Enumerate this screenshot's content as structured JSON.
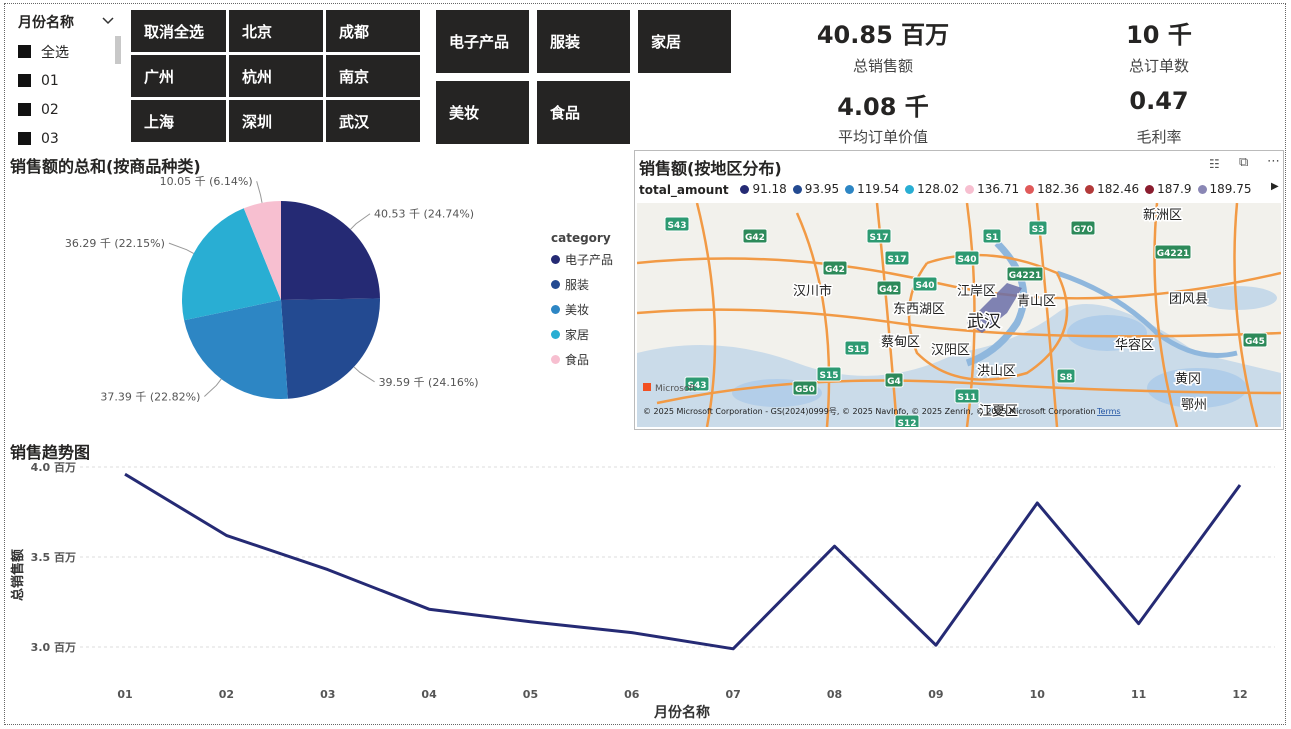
{
  "month_slicer": {
    "title": "月份名称",
    "items": [
      "全选",
      "01",
      "02",
      "03"
    ]
  },
  "city_tiles": [
    "取消全选",
    "北京",
    "成都",
    "广州",
    "杭州",
    "南京",
    "上海",
    "深圳",
    "武汉"
  ],
  "category_tiles": [
    "电子产品",
    "服装",
    "家居",
    "美妆",
    "食品"
  ],
  "kpis": [
    {
      "value": "40.85 百万",
      "label": "总销售额"
    },
    {
      "value": "10 千",
      "label": "总订单数"
    },
    {
      "value": "4.08 千",
      "label": "平均订单价值"
    },
    {
      "value": "0.47",
      "label": "毛利率"
    }
  ],
  "pie": {
    "title": "销售额的总和(按商品种类)",
    "legend_title": "category",
    "colors": {
      "电子产品": "#252a74",
      "服装": "#234a91",
      "美妆": "#2d86c4",
      "家居": "#29aed3",
      "食品": "#f7bfd0"
    },
    "slice_labels": [
      "40.53 千 (24.74%)",
      "39.59 千 (24.16%)",
      "37.39 千 (22.82%)",
      "36.29 千 (22.15%)",
      "10.05 千 (6.14%)"
    ]
  },
  "map": {
    "title": "销售额(按地区分布)",
    "legend_title": "total_amount",
    "legend_values": [
      "91.18",
      "93.95",
      "119.54",
      "128.02",
      "136.71",
      "182.36",
      "182.46",
      "187.9",
      "189.75"
    ],
    "legend_colors": [
      "#252a74",
      "#234a91",
      "#2d86c4",
      "#29aed3",
      "#f7bfd0",
      "#e05a5a",
      "#b33a3a",
      "#8b1d2f",
      "#8a87b5"
    ],
    "places": [
      "新洲区",
      "汉川市",
      "江岸区",
      "青山区",
      "团风县",
      "东西湖区",
      "武汉",
      "蔡甸区",
      "汉阳区",
      "华容区",
      "洪山区",
      "黄冈",
      "鄂州",
      "江夏区"
    ],
    "roads": [
      "S43",
      "G42",
      "S17",
      "S1",
      "S3",
      "G70",
      "G4221",
      "G42",
      "S17",
      "S40",
      "G4221",
      "G42",
      "S40",
      "S15",
      "S15",
      "G4",
      "G50",
      "S43",
      "S11",
      "S8",
      "G45",
      "S12"
    ],
    "copyright": "© 2025 Microsoft Corporation - GS(2024)0999号, © 2025 NavInfo, © 2025 Zenrin, © 2025 Microsoft Corporation",
    "terms": "Terms",
    "brand": "Microsoft"
  },
  "trend": {
    "title": "销售趋势图",
    "ylabel": "总销售额",
    "xlabel": "月份名称",
    "yticks": [
      "4.0 百万",
      "3.5 百万",
      "3.0 百万"
    ],
    "color": "#252a74"
  },
  "chart_data": [
    {
      "type": "pie",
      "title": "销售额的总和(按商品种类)",
      "categories": [
        "电子产品",
        "服装",
        "美妆",
        "家居",
        "食品"
      ],
      "values": [
        40.53,
        39.59,
        37.39,
        36.29,
        10.05
      ],
      "unit": "千",
      "percent": [
        24.74,
        24.16,
        22.82,
        22.15,
        6.14
      ],
      "legend": "right"
    },
    {
      "type": "line",
      "title": "销售趋势图",
      "xlabel": "月份名称",
      "ylabel": "总销售额",
      "x": [
        "01",
        "02",
        "03",
        "04",
        "05",
        "06",
        "07",
        "08",
        "09",
        "10",
        "11",
        "12"
      ],
      "series": [
        {
          "values": [
            3.96,
            3.62,
            3.43,
            3.21,
            3.14,
            3.08,
            2.99,
            3.56,
            3.01,
            3.8,
            3.13,
            3.9
          ]
        }
      ],
      "unit": "百万",
      "ylim": [
        3.0,
        4.0
      ],
      "grid": true
    }
  ]
}
